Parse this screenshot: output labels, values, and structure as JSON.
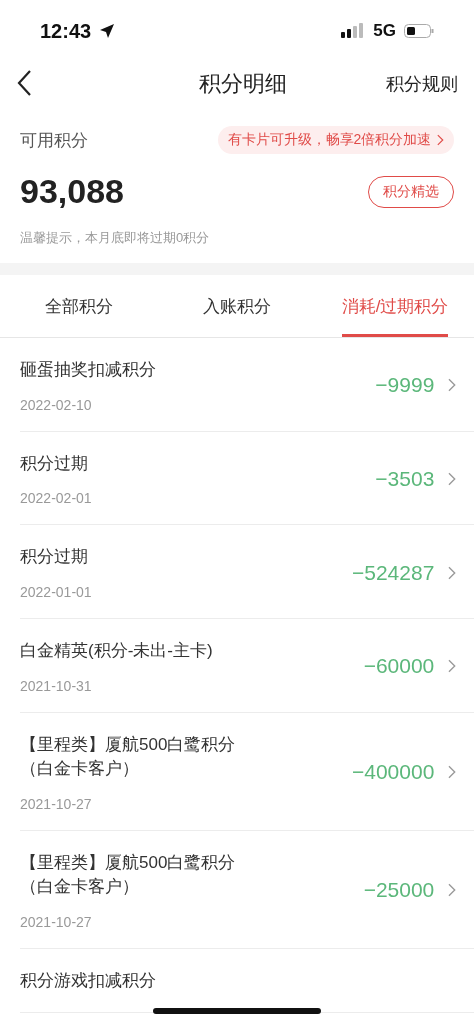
{
  "status_bar": {
    "time": "12:43",
    "network": "5G"
  },
  "nav": {
    "title": "积分明细",
    "action": "积分规则"
  },
  "balance": {
    "label": "可用积分",
    "promo": "有卡片可升级，畅享2倍积分加速",
    "value": "93,088",
    "button": "积分精选",
    "notice": "温馨提示，本月底即将过期0积分"
  },
  "tabs": [
    {
      "label": "全部积分",
      "selected": false
    },
    {
      "label": "入账积分",
      "selected": false
    },
    {
      "label": "消耗/过期积分",
      "selected": true
    }
  ],
  "records": [
    {
      "title": "砸蛋抽奖扣减积分",
      "date": "2022-02-10",
      "amount": "−9999"
    },
    {
      "title": "积分过期",
      "date": "2022-02-01",
      "amount": "−3503"
    },
    {
      "title": "积分过期",
      "date": "2022-01-01",
      "amount": "−524287"
    },
    {
      "title": "白金精英(积分-未出-主卡)",
      "date": "2021-10-31",
      "amount": "−60000"
    },
    {
      "title": "【里程类】厦航500白鹭积分（白金卡客户）",
      "date": "2021-10-27",
      "amount": "−400000"
    },
    {
      "title": "【里程类】厦航500白鹭积分（白金卡客户）",
      "date": "2021-10-27",
      "amount": "−25000"
    },
    {
      "title": "积分游戏扣减积分"
    }
  ]
}
